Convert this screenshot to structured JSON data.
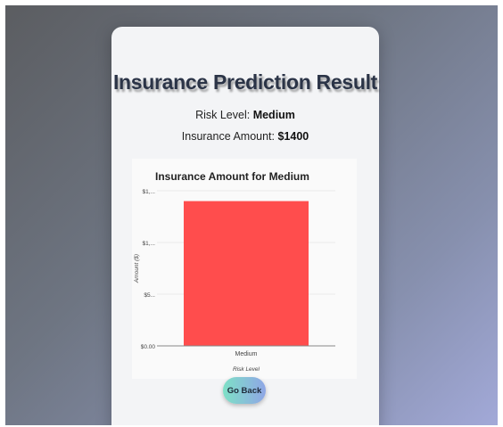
{
  "result": {
    "title": "Insurance Prediction Result",
    "risk_label": "Risk Level: ",
    "risk_value": "Medium",
    "amount_label": "Insurance Amount: ",
    "amount_value": "$1400"
  },
  "colors": {
    "bar": "#ff4d4d",
    "button_gradient_start": "#7ee0c6",
    "button_gradient_end": "#8fa6e6"
  },
  "chart_data": {
    "type": "bar",
    "title": "Insurance Amount for Medium",
    "categories": [
      "Medium"
    ],
    "values": [
      1400
    ],
    "xlabel": "Risk Level",
    "ylabel": "Amount ($)",
    "ylim": [
      0,
      1500
    ],
    "y_ticks": [
      {
        "value": 0,
        "label": "$0.00"
      },
      {
        "value": 500,
        "label": "$5..."
      },
      {
        "value": 1000,
        "label": "$1,..."
      },
      {
        "value": 1500,
        "label": "$1,..."
      }
    ],
    "grid": true,
    "legend": "none"
  },
  "actions": {
    "go_back_label": "Go Back"
  }
}
